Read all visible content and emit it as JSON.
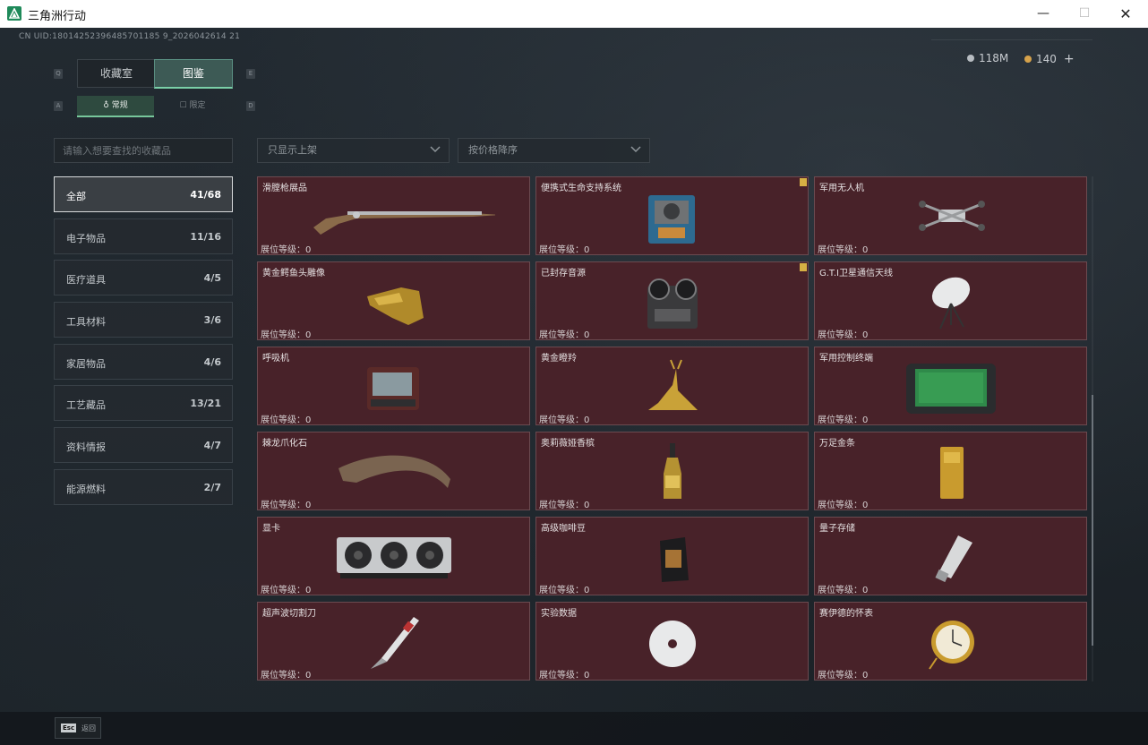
{
  "window": {
    "title": "三角洲行动"
  },
  "uid": "CN UID:18014252396485701185 9_2026042614 21",
  "currency": [
    {
      "icon": "silver-coin-icon",
      "value": "118M"
    },
    {
      "icon": "gold-coin-icon",
      "value": "140"
    }
  ],
  "currency_plus": "+",
  "tabs": [
    {
      "label": "收藏室",
      "active": false
    },
    {
      "label": "图鉴",
      "active": true
    }
  ],
  "tab_keys": {
    "left": "Q",
    "right": "E"
  },
  "subtabs": [
    {
      "label": "常规",
      "active": true
    },
    {
      "label": "限定",
      "active": false
    }
  ],
  "subtab_keys": {
    "left": "A",
    "right": "D"
  },
  "search": {
    "placeholder": "请输入想要查找的收藏品",
    "value": ""
  },
  "filters": [
    {
      "label": "只显示上架"
    },
    {
      "label": "按价格降序"
    }
  ],
  "categories": [
    {
      "name": "全部",
      "count": "41/68",
      "active": true
    },
    {
      "name": "电子物品",
      "count": "11/16"
    },
    {
      "name": "医疗道具",
      "count": "4/5"
    },
    {
      "name": "工具材料",
      "count": "3/6"
    },
    {
      "name": "家居物品",
      "count": "4/6"
    },
    {
      "name": "工艺藏品",
      "count": "13/21"
    },
    {
      "name": "资料情报",
      "count": "4/7"
    },
    {
      "name": "能源燃料",
      "count": "2/7"
    }
  ],
  "items": [
    {
      "name": "滑膛枪展品",
      "level": "展位等级：0",
      "icon": "musket-icon",
      "flag": false
    },
    {
      "name": "便携式生命支持系统",
      "level": "展位等级：0",
      "icon": "life-support-icon",
      "flag": true
    },
    {
      "name": "军用无人机",
      "level": "展位等级：0",
      "icon": "drone-icon",
      "flag": false
    },
    {
      "name": "黄金鳄鱼头雕像",
      "level": "展位等级：0",
      "icon": "golden-crocodile-head-icon",
      "flag": false
    },
    {
      "name": "已封存音源",
      "level": "展位等级：0",
      "icon": "reel-recorder-icon",
      "flag": true
    },
    {
      "name": "G.T.I卫星通信天线",
      "level": "展位等级：0",
      "icon": "satellite-dish-icon",
      "flag": false
    },
    {
      "name": "呼吸机",
      "level": "展位等级：0",
      "icon": "ventilator-icon",
      "flag": false
    },
    {
      "name": "黄金瞪羚",
      "level": "展位等级：0",
      "icon": "golden-gazelle-icon",
      "flag": false
    },
    {
      "name": "军用控制终端",
      "level": "展位等级：0",
      "icon": "control-terminal-icon",
      "flag": false
    },
    {
      "name": "棘龙爪化石",
      "level": "展位等级：0",
      "icon": "claw-fossil-icon",
      "flag": false
    },
    {
      "name": "奥莉薇娅香槟",
      "level": "展位等级：0",
      "icon": "champagne-icon",
      "flag": false
    },
    {
      "name": "万足金条",
      "level": "展位等级：0",
      "icon": "gold-bar-icon",
      "flag": false
    },
    {
      "name": "显卡",
      "level": "展位等级：0",
      "icon": "graphics-card-icon",
      "flag": false
    },
    {
      "name": "高级咖啡豆",
      "level": "展位等级：0",
      "icon": "coffee-bag-icon",
      "flag": false
    },
    {
      "name": "量子存储",
      "level": "展位等级：0",
      "icon": "quantum-storage-icon",
      "flag": false
    },
    {
      "name": "超声波切割刀",
      "level": "展位等级：0",
      "icon": "ultrasonic-knife-icon",
      "flag": false
    },
    {
      "name": "实验数据",
      "level": "展位等级：0",
      "icon": "disc-icon",
      "flag": false
    },
    {
      "name": "赛伊德的怀表",
      "level": "展位等级：0",
      "icon": "pocket-watch-icon",
      "flag": false
    }
  ],
  "footer": {
    "key": "Esc",
    "label": "返回"
  }
}
